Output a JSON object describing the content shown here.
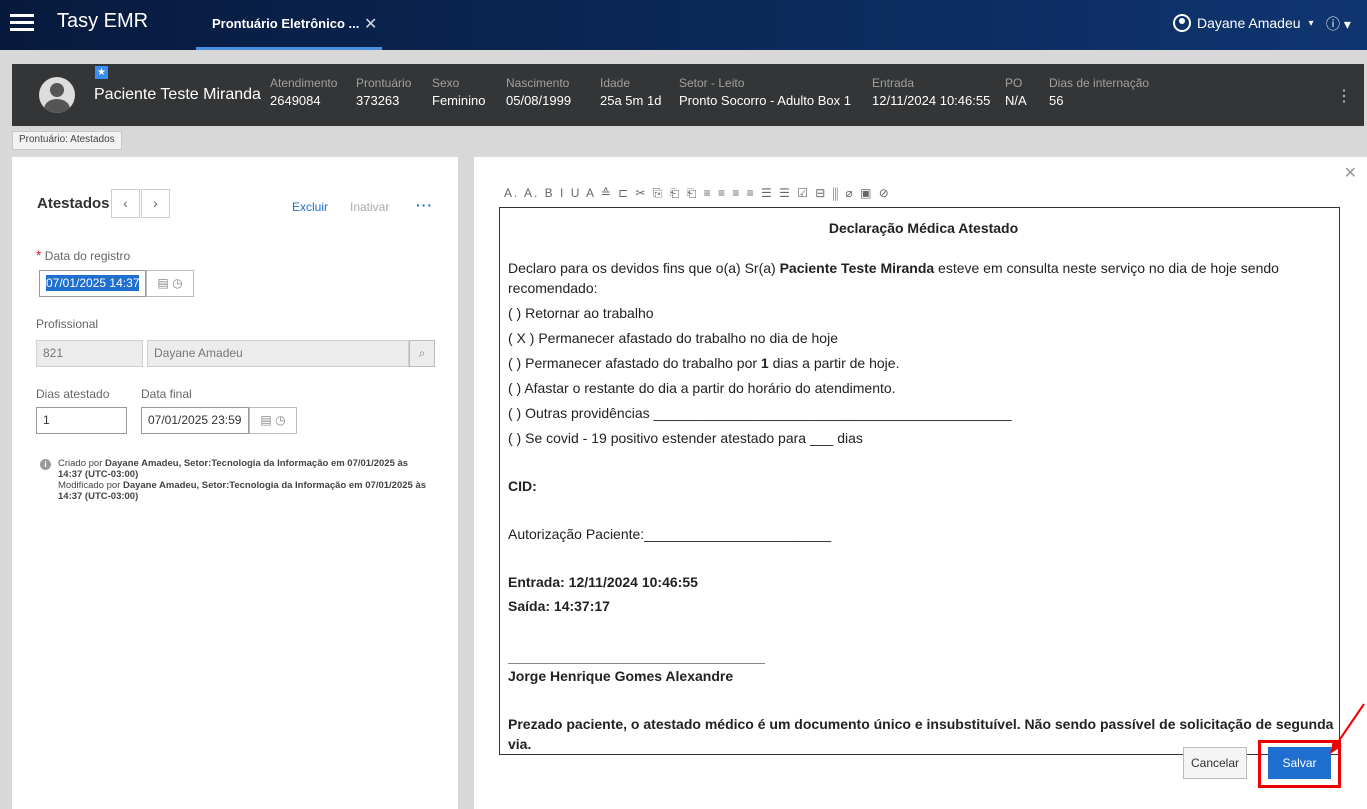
{
  "app": {
    "title": "Tasy EMR"
  },
  "tab": {
    "label": "Prontuário Eletrônico ...",
    "close": "✕"
  },
  "user": {
    "name": "Dayane Amadeu",
    "caret": "▾",
    "info": "ⓘ ▾"
  },
  "patient": {
    "name": "Paciente Teste Miranda",
    "star": "★",
    "fields": [
      {
        "label": "Atendimento",
        "value": "2649084"
      },
      {
        "label": "Prontuário",
        "value": "373263"
      },
      {
        "label": "Sexo",
        "value": "Feminino"
      },
      {
        "label": "Nascimento",
        "value": "05/08/1999"
      },
      {
        "label": "Idade",
        "value": "25a 5m 1d"
      },
      {
        "label": "Setor - Leito",
        "value": "Pronto Socorro - Adulto Box 1"
      },
      {
        "label": "Entrada",
        "value": "12/11/2024 10:46:55"
      },
      {
        "label": "PO",
        "value": "N/A"
      },
      {
        "label": "Dias de internação",
        "value": "56"
      }
    ],
    "menu": "⋮"
  },
  "breadcrumb": {
    "prefix": "Prontuário:",
    "current": "Atestados"
  },
  "left": {
    "title": "Atestados",
    "prev": "‹",
    "next": "›",
    "actions": {
      "excluir": "Excluir",
      "inativar": "Inativar",
      "more": "···"
    },
    "data_registro": {
      "label": "Data do registro",
      "required": "*",
      "value": "07/01/2025 14:37"
    },
    "profissional": {
      "label": "Profissional",
      "code": "821",
      "name": "Dayane Amadeu"
    },
    "dias_atestado": {
      "label": "Dias atestado",
      "value": "1"
    },
    "data_final": {
      "label": "Data final",
      "value": "07/01/2025 23:59"
    },
    "audit": {
      "created_prefix": "Criado por",
      "created_by": "Dayane Amadeu, Setor:Tecnologia da Informação em 07/01/2025 às",
      "created_time": "14:37 (UTC-03:00)",
      "modified_prefix": "Modificado por",
      "modified_by": "Dayane Amadeu, Setor:Tecnologia da Informação em 07/01/2025 às",
      "modified_time": "14:37 (UTC-03:00)"
    }
  },
  "editor": {
    "toolbar": "A. A. B I U A ≙ ⊏ ✂ ⎘ ⎗ ⎗ ≡ ≡ ≡ ≡ ☰ ☰ ☑ ⊟ ⫼ ⌀ ▣ ⊘",
    "doc": {
      "title": "Declaração Médica Atestado",
      "intro_a": "Declaro para os devidos fins que o(a) Sr(a) ",
      "intro_name": "Paciente Teste Miranda",
      "intro_b": " esteve em consulta neste serviço no dia de hoje sendo recomendado:",
      "opt1": "(    ) Retornar ao trabalho",
      "opt2": "( X ) Permanecer afastado do trabalho no dia de hoje",
      "opt3_a": "(    ) Permanecer afastado do trabalho por ",
      "opt3_days": "1",
      "opt3_b": " dias a partir de hoje.",
      "opt4": "(    ) Afastar o restante do dia a partir do horário do atendimento.",
      "opt5": "(    ) Outras providências ______________________________________________",
      "opt6": "(    ) Se covid - 19 positivo estender atestado para ___ dias",
      "cid": "CID:",
      "autorizacao": "Autorização Paciente:________________________",
      "entrada": "Entrada: 12/11/2024 10:46:55",
      "saida": "Saída: 14:37:17",
      "signature_line": "_________________________________",
      "doctor": "Jorge Henrique Gomes Alexandre",
      "footer": "Prezado paciente, o atestado médico é um documento único e insubstituível. Não sendo passível de solicitação de segunda via."
    }
  },
  "buttons": {
    "cancel": "Cancelar",
    "save": "Salvar"
  },
  "colors": {
    "accent": "#1f6fd1",
    "highlight": "#ee0000",
    "header": "#333537",
    "topbar": "#0c2a5c"
  }
}
